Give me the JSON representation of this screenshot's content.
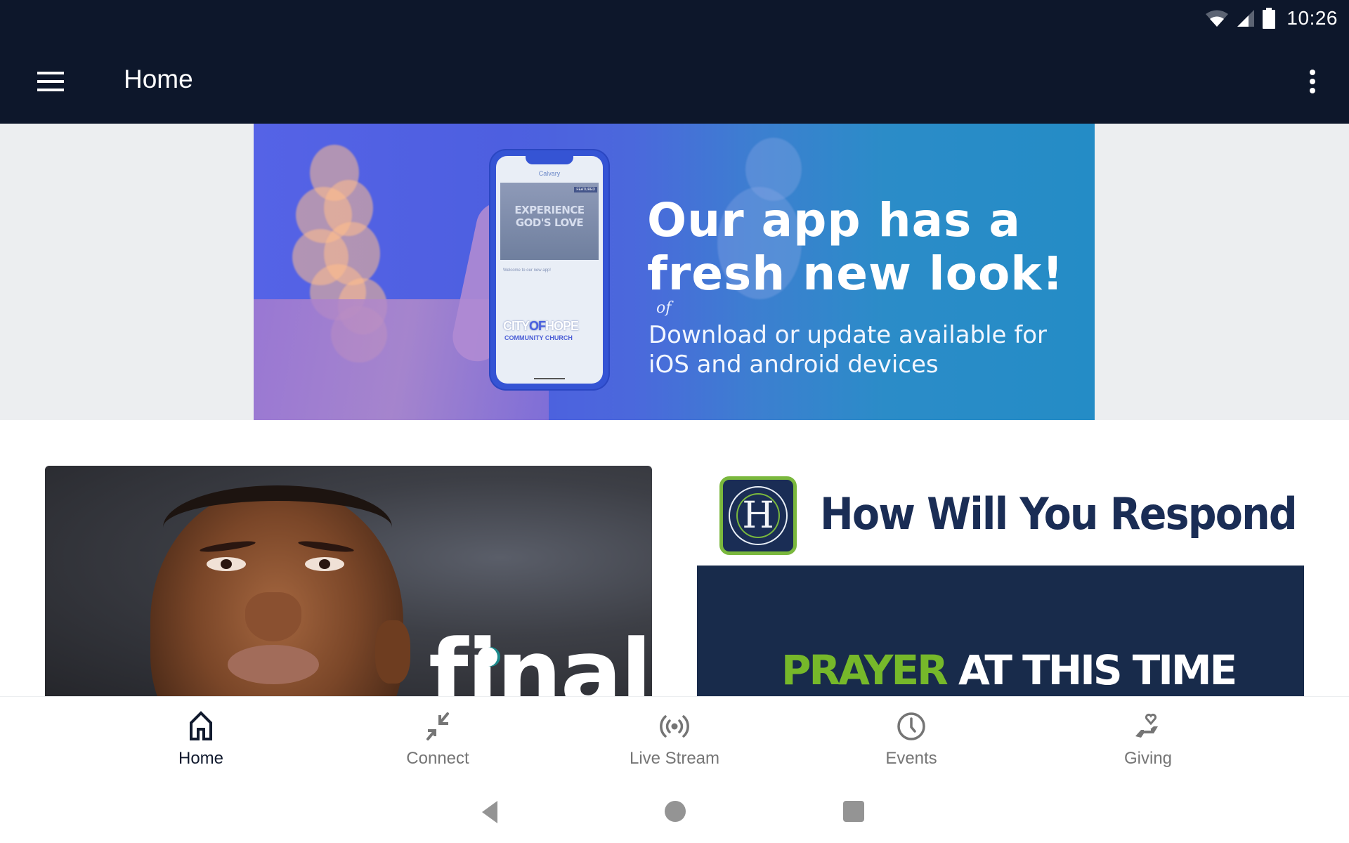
{
  "status_bar": {
    "time": "10:26",
    "icons": [
      "wifi-icon",
      "cellular-signal-icon",
      "battery-icon"
    ]
  },
  "app_bar": {
    "title": "Home",
    "menu_icon": "hamburger-menu-icon",
    "overflow_icon": "more-vert-icon"
  },
  "banner": {
    "headline_line1": "Our app has a",
    "headline_line2": "fresh new look!",
    "of_mark": "of",
    "subtext_line1": "Download or update available for",
    "subtext_line2": "iOS and android devices",
    "phone_screen": {
      "brand": "Calvary",
      "featured_tag": "FEATURED",
      "hero_line1": "EXPERIENCE",
      "hero_line2": "GOD'S LOVE",
      "welcome": "Welcome to our new app!",
      "church_city": "CITY",
      "church_of": "OF",
      "church_hope": "HOPE",
      "church_sub": "COMMUNITY CHURCH"
    }
  },
  "cards": [
    {
      "name": "final",
      "overlay_text": "final"
    },
    {
      "name": "how-will-you-respond",
      "logo_letter": "H",
      "title": "How Will You Respond",
      "subtitle_green": "PRAYER",
      "subtitle_white": "AT THIS TIME"
    }
  ],
  "bottom_nav": {
    "items": [
      {
        "label": "Home",
        "icon": "home-icon",
        "active": true
      },
      {
        "label": "Connect",
        "icon": "connect-arrows-icon",
        "active": false
      },
      {
        "label": "Live Stream",
        "icon": "live-stream-icon",
        "active": false
      },
      {
        "label": "Events",
        "icon": "clock-icon",
        "active": false
      },
      {
        "label": "Giving",
        "icon": "giving-hand-heart-icon",
        "active": false
      }
    ]
  },
  "system_nav": {
    "buttons": [
      "back-icon",
      "home-circle-icon",
      "recents-square-icon"
    ]
  },
  "colors": {
    "app_bar": "#0d172b",
    "banner_strip": "#eceef0",
    "active_nav": "#111a2e",
    "inactive_nav": "#757575",
    "hwyr_navy": "#182b4b",
    "hwyr_green": "#76b82a"
  }
}
